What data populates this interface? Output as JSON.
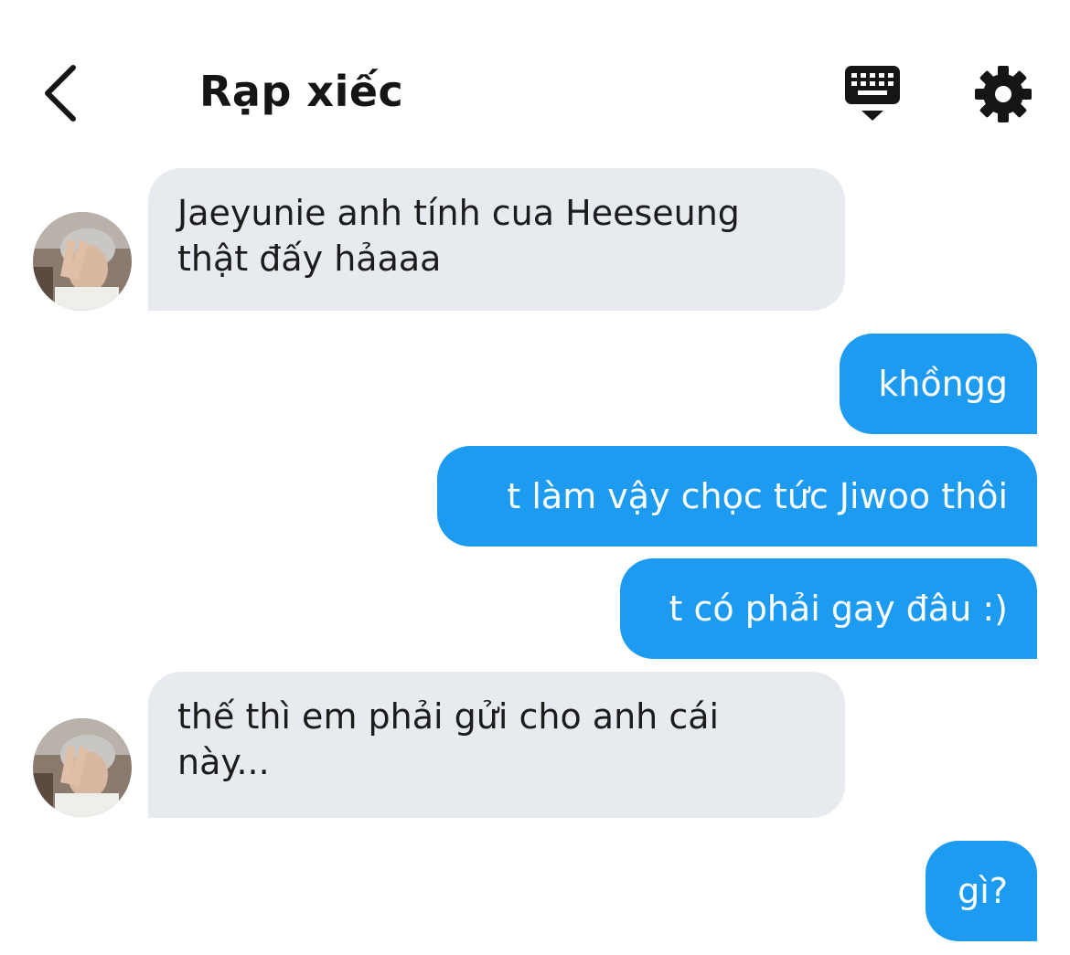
{
  "header": {
    "title": "Rạp xiếc",
    "back_icon": "chevron-left-icon",
    "keyboard_icon": "keyboard-icon",
    "settings_icon": "gear-icon"
  },
  "colors": {
    "outgoing_bubble": "#1d9bf0",
    "incoming_bubble": "#e7ebf0",
    "icon": "#151515"
  },
  "messages": [
    {
      "direction": "incoming",
      "lines": [
        "Jaeyunie anh tính cua Heeseung",
        "thật đấy hảaaa"
      ]
    },
    {
      "direction": "outgoing",
      "lines": [
        "khồngg"
      ]
    },
    {
      "direction": "outgoing",
      "lines": [
        "t làm vậy chọc tức Jiwoo thôi"
      ]
    },
    {
      "direction": "outgoing",
      "lines": [
        "t có phải gay đâu :)"
      ]
    },
    {
      "direction": "incoming",
      "lines": [
        "thế thì em phải gửi cho anh cái",
        "này..."
      ]
    },
    {
      "direction": "outgoing",
      "lines": [
        "gì?"
      ]
    }
  ]
}
